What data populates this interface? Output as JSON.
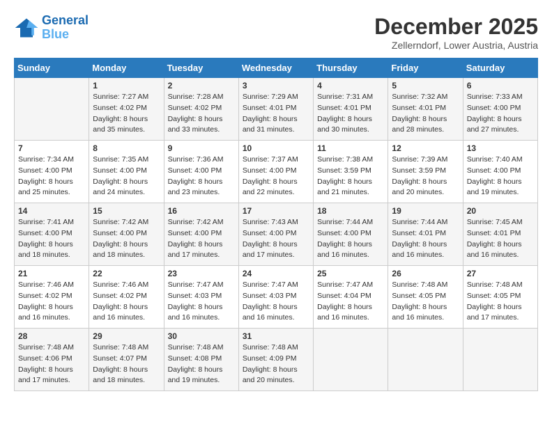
{
  "header": {
    "logo_line1": "General",
    "logo_line2": "Blue",
    "month_title": "December 2025",
    "subtitle": "Zellerndorf, Lower Austria, Austria"
  },
  "weekdays": [
    "Sunday",
    "Monday",
    "Tuesday",
    "Wednesday",
    "Thursday",
    "Friday",
    "Saturday"
  ],
  "weeks": [
    [
      {
        "day": "",
        "sunrise": "",
        "sunset": "",
        "daylight": ""
      },
      {
        "day": "1",
        "sunrise": "7:27 AM",
        "sunset": "4:02 PM",
        "daylight": "8 hours and 35 minutes."
      },
      {
        "day": "2",
        "sunrise": "7:28 AM",
        "sunset": "4:02 PM",
        "daylight": "8 hours and 33 minutes."
      },
      {
        "day": "3",
        "sunrise": "7:29 AM",
        "sunset": "4:01 PM",
        "daylight": "8 hours and 31 minutes."
      },
      {
        "day": "4",
        "sunrise": "7:31 AM",
        "sunset": "4:01 PM",
        "daylight": "8 hours and 30 minutes."
      },
      {
        "day": "5",
        "sunrise": "7:32 AM",
        "sunset": "4:01 PM",
        "daylight": "8 hours and 28 minutes."
      },
      {
        "day": "6",
        "sunrise": "7:33 AM",
        "sunset": "4:00 PM",
        "daylight": "8 hours and 27 minutes."
      }
    ],
    [
      {
        "day": "7",
        "sunrise": "7:34 AM",
        "sunset": "4:00 PM",
        "daylight": "8 hours and 25 minutes."
      },
      {
        "day": "8",
        "sunrise": "7:35 AM",
        "sunset": "4:00 PM",
        "daylight": "8 hours and 24 minutes."
      },
      {
        "day": "9",
        "sunrise": "7:36 AM",
        "sunset": "4:00 PM",
        "daylight": "8 hours and 23 minutes."
      },
      {
        "day": "10",
        "sunrise": "7:37 AM",
        "sunset": "4:00 PM",
        "daylight": "8 hours and 22 minutes."
      },
      {
        "day": "11",
        "sunrise": "7:38 AM",
        "sunset": "3:59 PM",
        "daylight": "8 hours and 21 minutes."
      },
      {
        "day": "12",
        "sunrise": "7:39 AM",
        "sunset": "3:59 PM",
        "daylight": "8 hours and 20 minutes."
      },
      {
        "day": "13",
        "sunrise": "7:40 AM",
        "sunset": "4:00 PM",
        "daylight": "8 hours and 19 minutes."
      }
    ],
    [
      {
        "day": "14",
        "sunrise": "7:41 AM",
        "sunset": "4:00 PM",
        "daylight": "8 hours and 18 minutes."
      },
      {
        "day": "15",
        "sunrise": "7:42 AM",
        "sunset": "4:00 PM",
        "daylight": "8 hours and 18 minutes."
      },
      {
        "day": "16",
        "sunrise": "7:42 AM",
        "sunset": "4:00 PM",
        "daylight": "8 hours and 17 minutes."
      },
      {
        "day": "17",
        "sunrise": "7:43 AM",
        "sunset": "4:00 PM",
        "daylight": "8 hours and 17 minutes."
      },
      {
        "day": "18",
        "sunrise": "7:44 AM",
        "sunset": "4:00 PM",
        "daylight": "8 hours and 16 minutes."
      },
      {
        "day": "19",
        "sunrise": "7:44 AM",
        "sunset": "4:01 PM",
        "daylight": "8 hours and 16 minutes."
      },
      {
        "day": "20",
        "sunrise": "7:45 AM",
        "sunset": "4:01 PM",
        "daylight": "8 hours and 16 minutes."
      }
    ],
    [
      {
        "day": "21",
        "sunrise": "7:46 AM",
        "sunset": "4:02 PM",
        "daylight": "8 hours and 16 minutes."
      },
      {
        "day": "22",
        "sunrise": "7:46 AM",
        "sunset": "4:02 PM",
        "daylight": "8 hours and 16 minutes."
      },
      {
        "day": "23",
        "sunrise": "7:47 AM",
        "sunset": "4:03 PM",
        "daylight": "8 hours and 16 minutes."
      },
      {
        "day": "24",
        "sunrise": "7:47 AM",
        "sunset": "4:03 PM",
        "daylight": "8 hours and 16 minutes."
      },
      {
        "day": "25",
        "sunrise": "7:47 AM",
        "sunset": "4:04 PM",
        "daylight": "8 hours and 16 minutes."
      },
      {
        "day": "26",
        "sunrise": "7:48 AM",
        "sunset": "4:05 PM",
        "daylight": "8 hours and 16 minutes."
      },
      {
        "day": "27",
        "sunrise": "7:48 AM",
        "sunset": "4:05 PM",
        "daylight": "8 hours and 17 minutes."
      }
    ],
    [
      {
        "day": "28",
        "sunrise": "7:48 AM",
        "sunset": "4:06 PM",
        "daylight": "8 hours and 17 minutes."
      },
      {
        "day": "29",
        "sunrise": "7:48 AM",
        "sunset": "4:07 PM",
        "daylight": "8 hours and 18 minutes."
      },
      {
        "day": "30",
        "sunrise": "7:48 AM",
        "sunset": "4:08 PM",
        "daylight": "8 hours and 19 minutes."
      },
      {
        "day": "31",
        "sunrise": "7:48 AM",
        "sunset": "4:09 PM",
        "daylight": "8 hours and 20 minutes."
      },
      {
        "day": "",
        "sunrise": "",
        "sunset": "",
        "daylight": ""
      },
      {
        "day": "",
        "sunrise": "",
        "sunset": "",
        "daylight": ""
      },
      {
        "day": "",
        "sunrise": "",
        "sunset": "",
        "daylight": ""
      }
    ]
  ],
  "labels": {
    "sunrise": "Sunrise:",
    "sunset": "Sunset:",
    "daylight": "Daylight:"
  }
}
